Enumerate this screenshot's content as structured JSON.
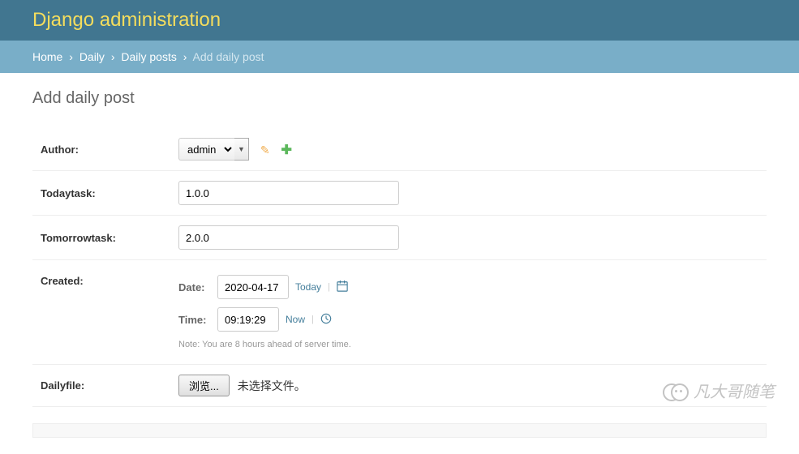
{
  "header": {
    "title": "Django administration"
  },
  "breadcrumbs": {
    "items": [
      "Home",
      "Daily",
      "Daily posts"
    ],
    "current": "Add daily post",
    "sep": "›"
  },
  "page": {
    "title": "Add daily post"
  },
  "form": {
    "author": {
      "label": "Author:",
      "value": "admin"
    },
    "todaytask": {
      "label": "Todaytask:",
      "value": "1.0.0"
    },
    "tomorrowtask": {
      "label": "Tomorrowtask:",
      "value": "2.0.0"
    },
    "created": {
      "label": "Created:",
      "date_label": "Date:",
      "date_value": "2020-04-17",
      "today": "Today",
      "time_label": "Time:",
      "time_value": "09:19:29",
      "now": "Now",
      "note": "Note: You are 8 hours ahead of server time."
    },
    "dailyfile": {
      "label": "Dailyfile:",
      "button": "浏览...",
      "status": "未选择文件。"
    }
  },
  "watermark": {
    "text": "凡大哥随笔"
  }
}
